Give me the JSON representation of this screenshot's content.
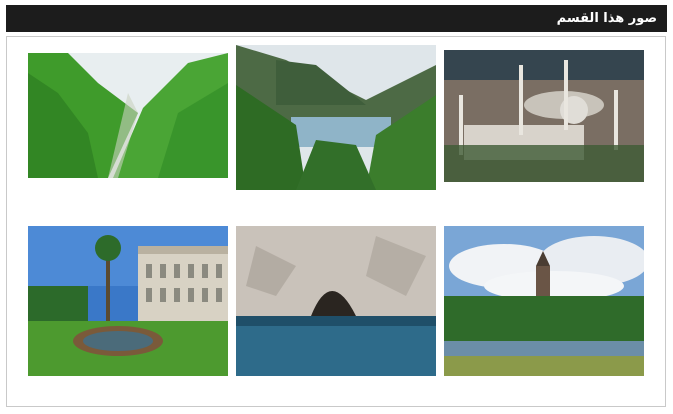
{
  "section": {
    "title": "صور هذا القسم"
  },
  "gallery": {
    "images": [
      {
        "subject": "green-forested-valley"
      },
      {
        "subject": "mountain-lake-village"
      },
      {
        "subject": "mosque-aerial-view"
      },
      {
        "subject": "palace-garden-pond"
      },
      {
        "subject": "sea-cave"
      },
      {
        "subject": "lakeside-church-tower"
      }
    ]
  }
}
